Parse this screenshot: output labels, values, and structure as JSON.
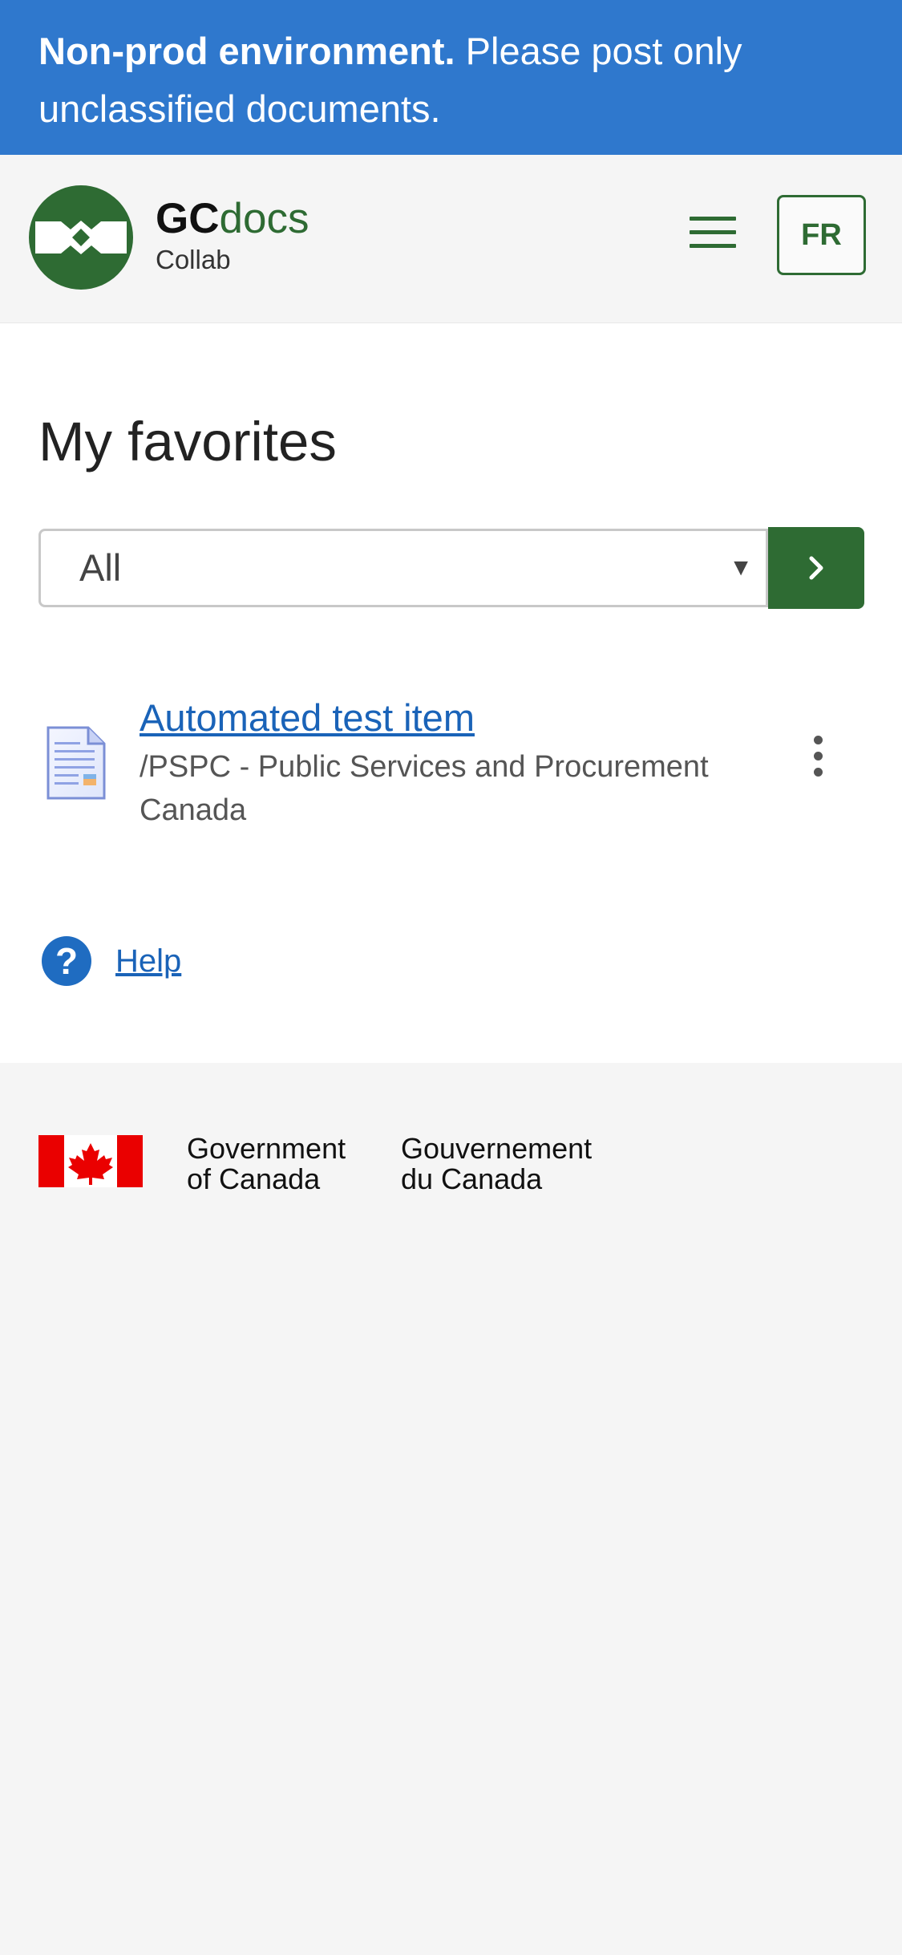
{
  "banner": {
    "strong": "Non-prod environment.",
    "line1_rest": " Please post only",
    "line2": "unclassified documents."
  },
  "header": {
    "brand_gc": "GC",
    "brand_docs": "docs",
    "brand_sub": "Collab",
    "menu_icon": "hamburger-menu-icon",
    "language_label": "FR"
  },
  "main": {
    "title": "My favorites",
    "filter": {
      "selected": "All",
      "caret": "▼",
      "go_icon": "chevron-right-icon"
    },
    "favorites": [
      {
        "title": "Automated test item",
        "path_line1": "/PSPC - Public Services and Procurement",
        "path_line2": "Canada",
        "icon": "document-icon",
        "actions_icon": "more-vertical-icon"
      }
    ],
    "help": {
      "icon_glyph": "?",
      "label": "Help"
    }
  },
  "footer": {
    "gov_en_line1": "Government",
    "gov_en_line2": "of Canada",
    "gov_fr_line1": "Gouvernement",
    "gov_fr_line2": "du Canada"
  },
  "colors": {
    "banner": "#2f78cd",
    "brand_green": "#2e6b33",
    "link": "#1a63b8",
    "flag_red": "#ea0000"
  }
}
